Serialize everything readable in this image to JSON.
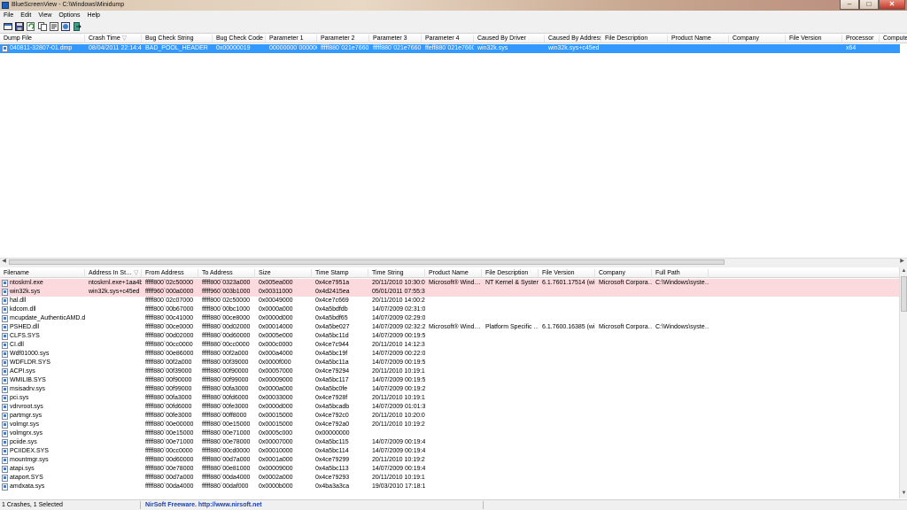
{
  "window": {
    "title": "BlueScreenView - C:\\Windows\\Minidump",
    "minimize": "–",
    "maximize": "□",
    "close": "✕"
  },
  "menu": [
    "File",
    "Edit",
    "View",
    "Options",
    "Help"
  ],
  "toolbar": [
    "options-icon",
    "save-icon",
    "refresh-icon",
    "copy-icon",
    "properties-icon",
    "html-report-icon",
    "exit-icon"
  ],
  "top_table": {
    "columns": [
      "Dump File",
      "Crash Time",
      "Bug Check String",
      "Bug Check Code",
      "Parameter 1",
      "Parameter 2",
      "Parameter 3",
      "Parameter 4",
      "Caused By Driver",
      "Caused By Address",
      "File Description",
      "Product Name",
      "Company",
      "File Version",
      "Processor",
      "Computer"
    ],
    "sort_indicator": "▽",
    "rows": [
      [
        "040811-32807-01.dmp",
        "08/04/2011 22:14:44",
        "BAD_POOL_HEADER",
        "0x00000019",
        "00000000`000000…",
        "fffff880`021e7660",
        "fffff880`021e7660",
        "ffeff880`021e7660",
        "win32k.sys",
        "win32k.sys+c45ed",
        "",
        "",
        "",
        "",
        "x64",
        ""
      ]
    ]
  },
  "bottom_table": {
    "columns": [
      "Filename",
      "Address In St…",
      "From Address",
      "To Address",
      "Size",
      "Time Stamp",
      "Time String",
      "Product Name",
      "File Description",
      "File Version",
      "Company",
      "Full Path"
    ],
    "sort_indicator": "▽",
    "rows": [
      [
        "ntoskrnl.exe",
        "ntoskrnl.exe+1aa4b3",
        "fffff800`02c50000",
        "fffff800`0323a000",
        "0x005ea000",
        "0x4ce7951a",
        "20/11/2010 10:30:02",
        "Microsoft® Wind…",
        "NT Kernel & System",
        "6.1.7601.17514 (wi…",
        "Microsoft Corpora…",
        "C:\\Windows\\syste…"
      ],
      [
        "win32k.sys",
        "win32k.sys+c45ed",
        "fffff960`000a0000",
        "fffff960`003b1000",
        "0x00311000",
        "0x4d2415ea",
        "05/01/2011 07:55:38",
        "",
        "",
        "",
        "",
        ""
      ],
      [
        "hal.dll",
        "",
        "fffff800`02c07000",
        "fffff800`02c50000",
        "0x00049000",
        "0x4ce7c669",
        "20/11/2010 14:00:25",
        "",
        "",
        "",
        "",
        ""
      ],
      [
        "kdcom.dll",
        "",
        "fffff800`00b67000",
        "fffff800`00bc1000",
        "0x0000a000",
        "0x4a5bdfdb",
        "14/07/2009 02:31:07",
        "",
        "",
        "",
        "",
        ""
      ],
      [
        "mcupdate_AuthenticAMD.dll",
        "",
        "fffff880`00c41000",
        "fffff880`00ce8000",
        "0x0000d000",
        "0x4a5bdf65",
        "14/07/2009 02:29:09",
        "",
        "",
        "",
        "",
        ""
      ],
      [
        "PSHED.dll",
        "",
        "fffff880`00ce0000",
        "fffff880`00d02000",
        "0x00014000",
        "0x4a5be027",
        "14/07/2009 02:32:23",
        "Microsoft® Wind…",
        "Platform Specific …",
        "6.1.7600.16385 (wi…",
        "Microsoft Corpora…",
        "C:\\Windows\\syste…"
      ],
      [
        "CLFS.SYS",
        "",
        "fffff880`00d02000",
        "fffff880`00d60000",
        "0x0005e000",
        "0x4a5bc11d",
        "14/07/2009 00:19:57",
        "",
        "",
        "",
        "",
        ""
      ],
      [
        "CI.dll",
        "",
        "fffff880`00cc0000",
        "fffff880`00cc0000",
        "0x000c0000",
        "0x4ce7c944",
        "20/11/2010 14:12:36",
        "",
        "",
        "",
        "",
        ""
      ],
      [
        "Wdf01000.sys",
        "",
        "fffff880`00e86000",
        "fffff880`00f2a000",
        "0x000a4000",
        "0x4a5bc19f",
        "14/07/2009 00:22:07",
        "",
        "",
        "",
        "",
        ""
      ],
      [
        "WDFLDR.SYS",
        "",
        "fffff880`00f2a000",
        "fffff880`00f39000",
        "0x0000f000",
        "0x4a5bc11a",
        "14/07/2009 00:19:54",
        "",
        "",
        "",
        "",
        ""
      ],
      [
        "ACPI.sys",
        "",
        "fffff880`00f39000",
        "fffff880`00f90000",
        "0x00057000",
        "0x4ce79294",
        "20/11/2010 10:19:16",
        "",
        "",
        "",
        "",
        ""
      ],
      [
        "WMILIB.SYS",
        "",
        "fffff880`00f90000",
        "fffff880`00f99000",
        "0x00009000",
        "0x4a5bc117",
        "14/07/2009 00:19:51",
        "",
        "",
        "",
        "",
        ""
      ],
      [
        "msisadrv.sys",
        "",
        "fffff880`00f99000",
        "fffff880`00fa3000",
        "0x0000a000",
        "0x4a5bc0fe",
        "14/07/2009 00:19:26",
        "",
        "",
        "",
        "",
        ""
      ],
      [
        "pci.sys",
        "",
        "fffff880`00fa3000",
        "fffff880`00fd6000",
        "0x00033000",
        "0x4ce7928f",
        "20/11/2010 10:19:11",
        "",
        "",
        "",
        "",
        ""
      ],
      [
        "vdrvroot.sys",
        "",
        "fffff880`00fd6000",
        "fffff880`00fe3000",
        "0x0000d000",
        "0x4a5bcadb",
        "14/07/2009 01:01:31",
        "",
        "",
        "",
        "",
        ""
      ],
      [
        "partmgr.sys",
        "",
        "fffff880`00fe3000",
        "fffff880`00ff8000",
        "0x00015000",
        "0x4ce792c0",
        "20/11/2010 10:20:00",
        "",
        "",
        "",
        "",
        ""
      ],
      [
        "volmgr.sys",
        "",
        "fffff880`00e00000",
        "fffff880`00e15000",
        "0x00015000",
        "0x4ce792a0",
        "20/11/2010 10:19:28",
        "",
        "",
        "",
        "",
        ""
      ],
      [
        "volmgrx.sys",
        "",
        "fffff880`00e15000",
        "fffff880`00e71000",
        "0x0005c000",
        "0x00000000",
        "",
        "",
        "",
        "",
        "",
        ""
      ],
      [
        "pciide.sys",
        "",
        "fffff880`00e71000",
        "fffff880`00e78000",
        "0x00007000",
        "0x4a5bc115",
        "14/07/2009 00:19:49",
        "",
        "",
        "",
        "",
        ""
      ],
      [
        "PCIIDEX.SYS",
        "",
        "fffff880`00cc0000",
        "fffff880`00cd0000",
        "0x00010000",
        "0x4a5bc114",
        "14/07/2009 00:19:48",
        "",
        "",
        "",
        "",
        ""
      ],
      [
        "mountmgr.sys",
        "",
        "fffff880`00d60000",
        "fffff880`00d7a000",
        "0x0001a000",
        "0x4ce79299",
        "20/11/2010 10:19:21",
        "",
        "",
        "",
        "",
        ""
      ],
      [
        "atapi.sys",
        "",
        "fffff880`00e78000",
        "fffff880`00e81000",
        "0x00009000",
        "0x4a5bc113",
        "14/07/2009 00:19:47",
        "",
        "",
        "",
        "",
        ""
      ],
      [
        "ataport.SYS",
        "",
        "fffff880`00d7a000",
        "fffff880`00da4000",
        "0x0002a000",
        "0x4ce79293",
        "20/11/2010 10:19:15",
        "",
        "",
        "",
        "",
        ""
      ],
      [
        "amdxata.sys",
        "",
        "fffff880`00da4000",
        "fffff880`00daf000",
        "0x0000b000",
        "0x4ba3a3ca",
        "19/03/2010 17:18:18",
        "",
        "",
        "",
        "",
        ""
      ]
    ]
  },
  "status": {
    "count": "1 Crashes, 1 Selected",
    "vendor": "NirSoft Freeware.  http://www.nirsoft.net"
  },
  "colors": {
    "selected": "#3399ff",
    "highlight": "#fbd9dd"
  }
}
